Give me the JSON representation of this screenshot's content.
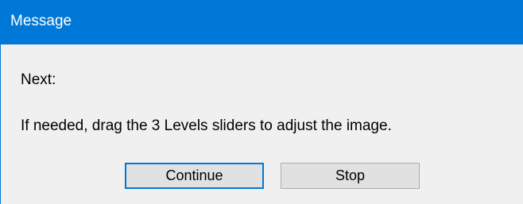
{
  "window": {
    "title": "Message"
  },
  "message": {
    "heading": "Next:",
    "instruction": "If needed, drag the 3 Levels sliders to adjust the image."
  },
  "buttons": {
    "continue_label": "Continue",
    "stop_label": "Stop"
  },
  "colors": {
    "titlebar": "#0078d7",
    "title_text": "#ffffff",
    "dialog_background": "#f0f0f0",
    "button_background": "#e1e1e1",
    "default_button_border": "#0078d7"
  }
}
